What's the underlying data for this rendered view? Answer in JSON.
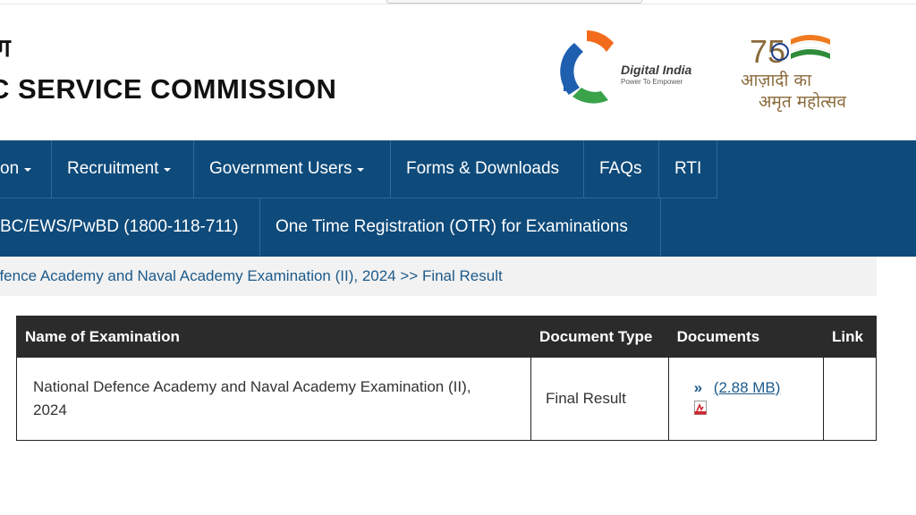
{
  "header": {
    "hindi_title": "ग",
    "org_title": "C SERVICE COMMISSION",
    "digital_india": {
      "title": "Digital India",
      "tagline": "Power To Empower"
    },
    "azadi": {
      "number": "75",
      "line1": "आज़ादी का",
      "line2": "अमृत महोत्सव"
    }
  },
  "nav": {
    "row1": [
      {
        "label": "on",
        "has_dropdown": true
      },
      {
        "label": "Recruitment",
        "has_dropdown": true
      },
      {
        "label": "Government Users",
        "has_dropdown": true
      },
      {
        "label": "Forms & Downloads",
        "has_dropdown": false
      },
      {
        "label": "FAQs",
        "has_dropdown": false
      },
      {
        "label": "RTI",
        "has_dropdown": false
      }
    ],
    "row2": [
      {
        "label": "BC/EWS/PwBD (1800-118-711)"
      },
      {
        "label": "One Time Registration (OTR) for Examinations"
      }
    ]
  },
  "breadcrumb": {
    "text": "efence Academy and Naval Academy Examination (II), 2024 >> Final Result"
  },
  "table": {
    "headers": [
      "Name of Examination",
      "Document Type",
      "Documents",
      "Link"
    ],
    "rows": [
      {
        "name_line1": "National Defence Academy and Naval Academy Examination (II),",
        "name_line2": "2024",
        "type": "Final Result",
        "doc_marker": "»",
        "doc_size": "(2.88 MB)",
        "link": ""
      }
    ]
  },
  "colors": {
    "nav_bg": "#0e4a7a",
    "table_header_bg": "#2b2b2b",
    "link": "#1d5a8a"
  }
}
